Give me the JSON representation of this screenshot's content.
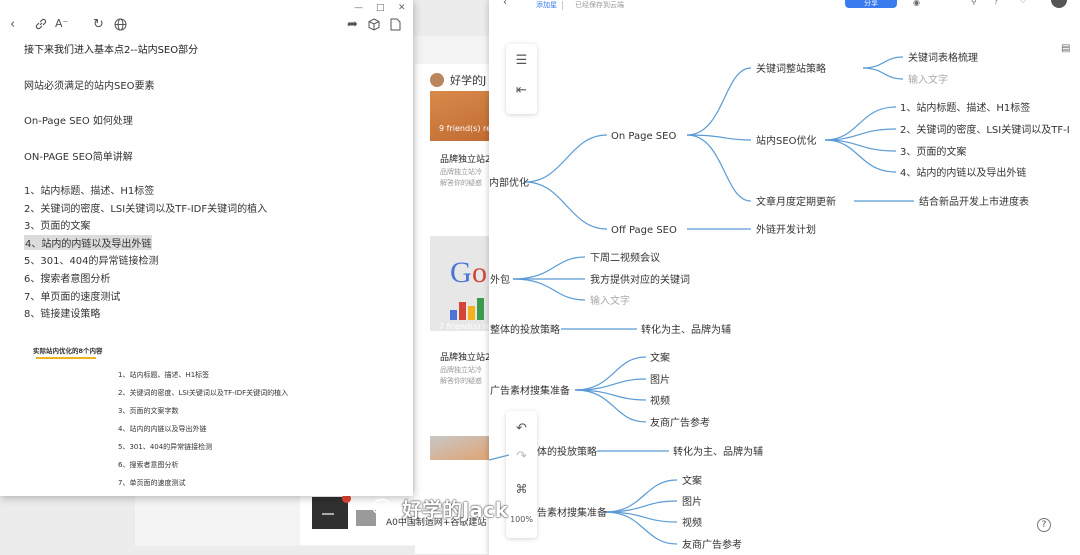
{
  "background_window": {
    "author": "好学的J",
    "card1_stat": "9 friend(s) re",
    "card1_title": "品牌独立站2",
    "card1_sub1": "品牌独立站冷",
    "card1_sub2": "解答你的疑惑",
    "card2_stat": "7 friend(s) re",
    "card2_title": "品牌独立站2",
    "card2_sub1": "品牌独立站冷",
    "card2_sub2": "解答你的疑惑",
    "footer_text": "A0中国制造网+谷歌建站"
  },
  "notes": {
    "lines": [
      "接下来我们进入基本点2--站内SEO部分",
      "网站必须满足的站内SEO要素",
      "On-Page SEO 如何处理",
      "ON-PAGE SEO简单讲解",
      "1、站内标题、描述、H1标签",
      "2、关键词的密度、LSI关键词以及TF-IDF关键词的植入",
      "3、页面的文案",
      "4、站内的内链以及导出外链",
      "5、301、404的异常链接检测",
      "6、搜索者意图分析",
      "7、单页面的速度测试",
      "8、链接建设策略"
    ],
    "caption": "实际站内优化的8个内容",
    "sub_items": [
      "1、站内标题、描述、H1标签",
      "2、关键词的密度、LSI关键词以及TF-IDF关键词的植入",
      "3、页面的文案字数",
      "4、站内的内链以及导出外链",
      "5、301、404的异常链接检测",
      "6、搜索者意图分析",
      "7、单页面的速度测试"
    ]
  },
  "mindmap": {
    "topbar": {
      "add_label": "添加星",
      "saved": "已经保存到云端",
      "share": "分享"
    },
    "zoom": "100%",
    "help": "?",
    "watermark": "好学的Jack",
    "nodes": {
      "internal": "内部优化",
      "on_page": "On Page SEO",
      "off_page": "Off Page SEO",
      "kw_strategy": "关键词整站策略",
      "kw_table": "关键词表格梳理",
      "input1": "输入文字",
      "onsite": "站内SEO优化",
      "o1": "1、站内标题、描述、H1标签",
      "o2": "2、关键词的密度、LSI关键词以及TF-I",
      "o3": "3、页面的文案",
      "o4": "4、站内的内链以及导出外链",
      "monthly": "文章月度定期更新",
      "new_products": "结合新品开发上市进度表",
      "ext_links": "外链开发计划",
      "outsource": "外包",
      "meeting": "下周二视频会议",
      "keywords": "我方提供对应的关键词",
      "input2": "输入文字",
      "ad_strategy": "整体的投放策略",
      "ad_strategy_val": "转化为主、品牌为辅",
      "material": "广告素材搜集准备",
      "m1": "文案",
      "m2": "图片",
      "m3": "视频",
      "m4": "友商广告参考",
      "ad_strategy2": "体的投放策略",
      "ad_strategy2_val": "转化为主、品牌为辅",
      "material2": "告素材搜集准备",
      "n1": "文案",
      "n2": "图片",
      "n3": "视频",
      "n4": "友商广告参考"
    }
  },
  "colors": {
    "branch": "#5b9bd5",
    "accent": "#3a7bf0",
    "highlight": "#f2b21e"
  }
}
